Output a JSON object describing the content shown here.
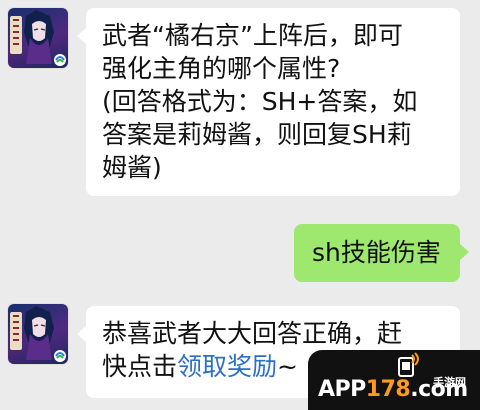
{
  "chat": {
    "messages": [
      {
        "side": "left",
        "lines": [
          "武者“橘右京”上阵后，即可",
          "强化主角的哪个属性?",
          "(回答格式为：SH+答案，如",
          "答案是莉姆酱，则回复SH莉",
          "姆酱)"
        ]
      },
      {
        "side": "right",
        "lines": [
          "sh技能伤害"
        ]
      },
      {
        "side": "left",
        "line1": "恭喜武者大大回答正确，赶",
        "line2_prefix": "快点击",
        "line2_link": "领取奖励",
        "line2_suffix": "~"
      }
    ]
  },
  "watermark": {
    "brand_prefix": "APP",
    "brand_accent": "178",
    "brand_suffix": ".com",
    "sub": "手游网"
  },
  "colors": {
    "chat_background": "#ebebeb",
    "incoming_bubble": "#ffffff",
    "outgoing_bubble": "#9ee870",
    "link": "#2b6fc6",
    "watermark_accent": "#ff9a1c"
  },
  "icons": {
    "avatar": "game-character-avatar",
    "brand": "brand-logo-icon",
    "watermark": "app178-logo"
  }
}
